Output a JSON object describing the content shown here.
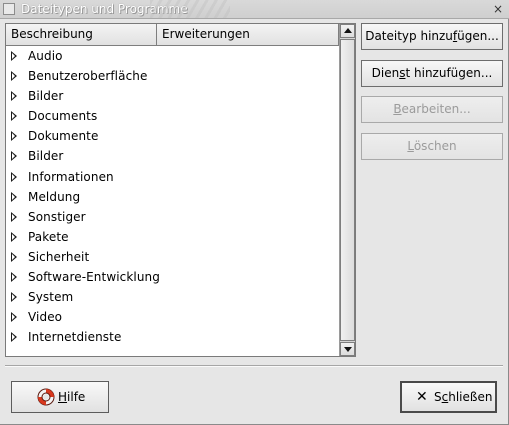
{
  "window": {
    "title": "Dateitypen und Programme",
    "close_glyph": "×"
  },
  "list": {
    "columns": [
      "Beschreibung",
      "Erweiterungen"
    ],
    "items": [
      "Audio",
      "Benutzeroberfläche",
      "Bilder",
      "Documents",
      "Dokumente",
      "Bilder",
      "Informationen",
      "Meldung",
      "Sonstiger",
      "Pakete",
      "Sicherheit",
      "Software-Entwicklung",
      "System",
      "Video",
      "Internetdienste"
    ]
  },
  "buttons": {
    "add_type": {
      "pre": "Dateityp hinzu",
      "mnemonic": "f",
      "post": "ügen..."
    },
    "add_service": {
      "pre": "Dien",
      "mnemonic": "s",
      "post": "t hinzufügen..."
    },
    "edit": {
      "pre": "",
      "mnemonic": "B",
      "post": "earbeiten..."
    },
    "delete": {
      "pre": "",
      "mnemonic": "L",
      "post": "öschen"
    },
    "help": {
      "pre": "",
      "mnemonic": "H",
      "post": "ilfe"
    },
    "close": {
      "pre": "S",
      "mnemonic": "c",
      "post": "hließen"
    }
  },
  "icons": {
    "help": "lifebuoy-icon",
    "close": "x-icon",
    "expander": "triangle-right-icon"
  },
  "state": {
    "edit_disabled": true,
    "delete_disabled": true
  }
}
